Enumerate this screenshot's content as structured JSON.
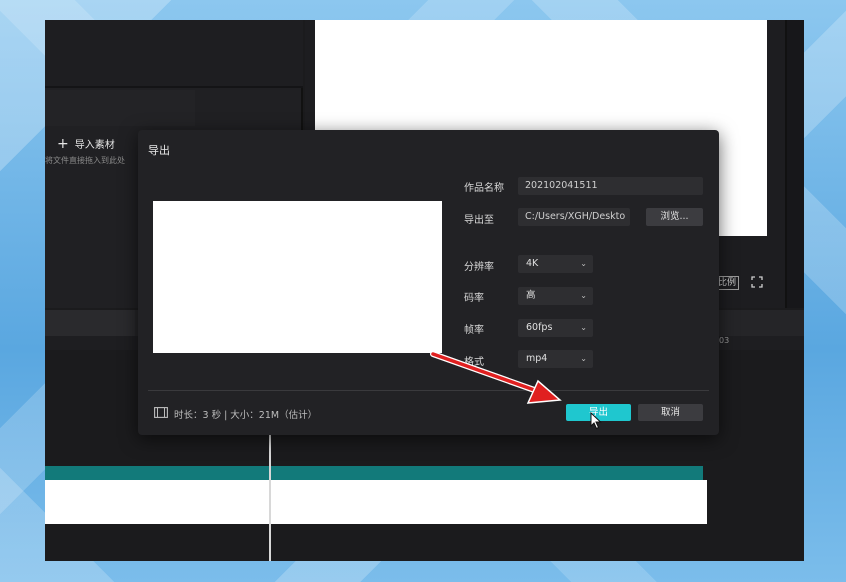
{
  "left_panel": {
    "import_label": "导入素材",
    "import_hint": "将文件直接拖入到此处"
  },
  "player": {
    "ratio_label": "比例",
    "ruler_time": "03"
  },
  "dialog": {
    "title": "导出",
    "fields": {
      "name_label": "作品名称",
      "name_value": "202102041511",
      "path_label": "导出至",
      "path_value": "C:/Users/XGH/Deskto",
      "browse_label": "浏览..."
    },
    "settings": {
      "resolution_label": "分辨率",
      "resolution_value": "4K",
      "bitrate_label": "码率",
      "bitrate_value": "高",
      "framerate_label": "帧率",
      "framerate_value": "60fps",
      "format_label": "格式",
      "format_value": "mp4"
    },
    "footer": {
      "info": "时长：3 秒 | 大小：21M（估计）"
    },
    "export_label": "导出",
    "cancel_label": "取消"
  },
  "colors": {
    "accent": "#1fc7cf",
    "annotation_arrow": "#e02020",
    "track_teal": "#127a7a"
  }
}
